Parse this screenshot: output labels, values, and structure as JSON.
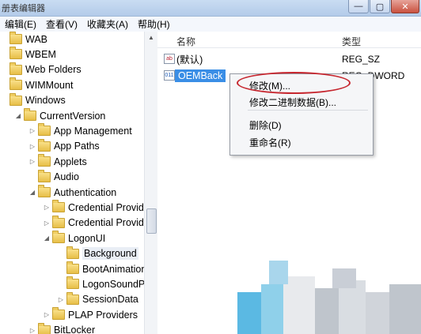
{
  "window": {
    "title": "册表编辑器",
    "controls": {
      "minimize": "—",
      "maximize": "▢",
      "close": "✕"
    }
  },
  "menu": [
    "编辑(E)",
    "查看(V)",
    "收藏夹(A)",
    "帮助(H)"
  ],
  "tree": {
    "items": [
      {
        "label": "WAB",
        "level": 0,
        "expander": ""
      },
      {
        "label": "WBEM",
        "level": 0,
        "expander": ""
      },
      {
        "label": "Web Folders",
        "level": 0,
        "expander": ""
      },
      {
        "label": "WIMMount",
        "level": 0,
        "expander": ""
      },
      {
        "label": "Windows",
        "level": 0,
        "expander": ""
      },
      {
        "label": "CurrentVersion",
        "level": 1,
        "expander": "◢"
      },
      {
        "label": "App Management",
        "level": 2,
        "expander": "▷"
      },
      {
        "label": "App Paths",
        "level": 2,
        "expander": "▷"
      },
      {
        "label": "Applets",
        "level": 2,
        "expander": "▷"
      },
      {
        "label": "Audio",
        "level": 2,
        "expander": ""
      },
      {
        "label": "Authentication",
        "level": 2,
        "expander": "◢"
      },
      {
        "label": "Credential Provide",
        "level": 3,
        "expander": "▷"
      },
      {
        "label": "Credential Provide",
        "level": 3,
        "expander": "▷"
      },
      {
        "label": "LogonUI",
        "level": 3,
        "expander": "◢"
      },
      {
        "label": "Background",
        "level": 4,
        "expander": "",
        "selected": true
      },
      {
        "label": "BootAnimation",
        "level": 4,
        "expander": ""
      },
      {
        "label": "LogonSoundPla",
        "level": 4,
        "expander": ""
      },
      {
        "label": "SessionData",
        "level": 4,
        "expander": "▷"
      },
      {
        "label": "PLAP Providers",
        "level": 3,
        "expander": "▷"
      },
      {
        "label": "BitLocker",
        "level": 2,
        "expander": "▷"
      }
    ]
  },
  "values_pane": {
    "header": {
      "name": "名称",
      "type": "类型"
    },
    "rows": [
      {
        "name": "(默认)",
        "type": "REG_SZ",
        "icon": "string-value-icon",
        "icon_text": "ab"
      },
      {
        "name": "OEMBack",
        "type": "REG_DWORD",
        "icon": "binary-value-icon",
        "icon_text": "011",
        "selected": true
      }
    ]
  },
  "context_menu": {
    "items": [
      "修改(M)...",
      "修改二进制数据(B)...",
      "删除(D)",
      "重命名(R)"
    ],
    "highlight_color": "#c6262e"
  },
  "colors": {
    "selection": "#3a8ee6",
    "title_bar": "#c9dcf2"
  }
}
